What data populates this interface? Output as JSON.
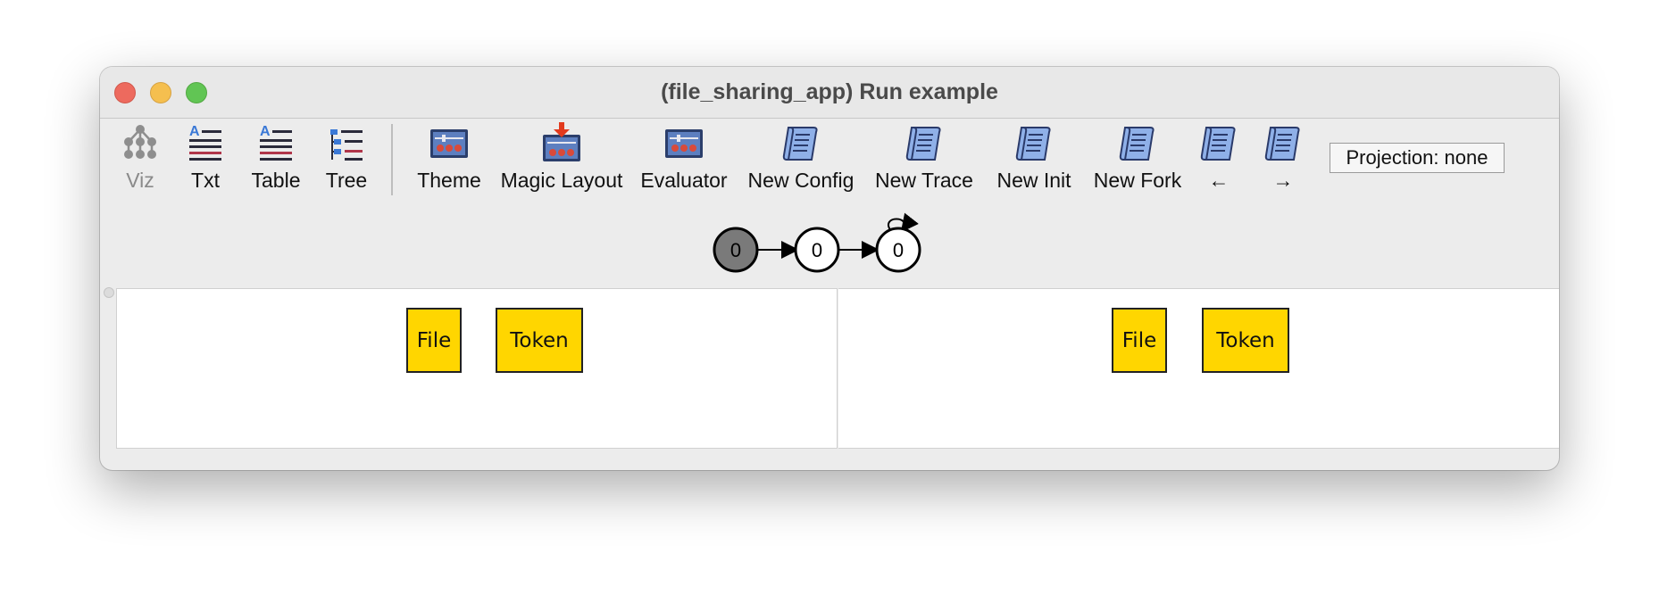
{
  "window": {
    "title": "(file_sharing_app) Run example",
    "controls": [
      "close",
      "minimize",
      "maximize"
    ]
  },
  "toolbar": {
    "buttons": [
      {
        "label": "Viz",
        "icon": "viz-tree-icon",
        "enabled": false
      },
      {
        "label": "Txt",
        "icon": "text-lines-icon",
        "enabled": true
      },
      {
        "label": "Table",
        "icon": "table-lines-icon",
        "enabled": true
      },
      {
        "label": "Tree",
        "icon": "tree-list-icon",
        "enabled": true
      },
      {
        "label": "Theme",
        "icon": "theme-panel-icon",
        "enabled": true
      },
      {
        "label": "Magic Layout",
        "icon": "magic-layout-icon",
        "enabled": true
      },
      {
        "label": "Evaluator",
        "icon": "evaluator-panel-icon",
        "enabled": true
      },
      {
        "label": "New Config",
        "icon": "scroll-icon",
        "enabled": true
      },
      {
        "label": "New Trace",
        "icon": "scroll-icon",
        "enabled": true
      },
      {
        "label": "New Init",
        "icon": "scroll-icon",
        "enabled": true
      },
      {
        "label": "New Fork",
        "icon": "scroll-icon",
        "enabled": true
      },
      {
        "label": "←",
        "icon": "scroll-icon",
        "enabled": true
      },
      {
        "label": "→",
        "icon": "scroll-icon",
        "enabled": true
      }
    ],
    "projection": "Projection: none"
  },
  "trace_graph": {
    "nodes": [
      {
        "label": "0",
        "state": "current"
      },
      {
        "label": "0",
        "state": "normal"
      },
      {
        "label": "0",
        "state": "normal"
      }
    ],
    "edges": [
      "0->1",
      "1->2",
      "2->2 (self-loop)"
    ],
    "colors": {
      "current_fill": "#7a7a7a",
      "normal_fill": "#ffffff"
    }
  },
  "panels": {
    "left": {
      "sigs": [
        "File",
        "Token"
      ]
    },
    "right": {
      "sigs": [
        "File",
        "Token"
      ]
    }
  },
  "colors": {
    "sig_fill": "#ffd600",
    "sig_border": "#222222",
    "scroll_icon": "#6f8fcf"
  }
}
